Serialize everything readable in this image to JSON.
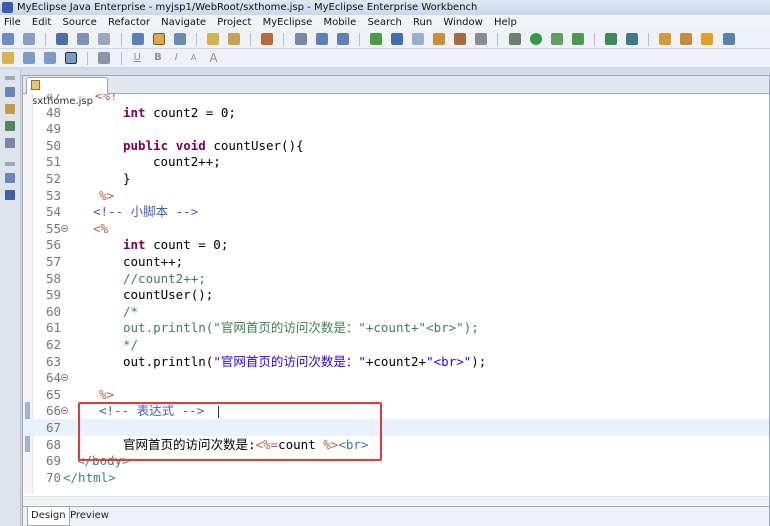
{
  "window": {
    "title": "MyEclipse Java Enterprise - myjsp1/WebRoot/sxthome.jsp - MyEclipse Enterprise Workbench"
  },
  "menu": [
    "File",
    "Edit",
    "Source",
    "Refactor",
    "Navigate",
    "Project",
    "MyEclipse",
    "Mobile",
    "Search",
    "Run",
    "Window",
    "Help"
  ],
  "format_toolbar": {
    "underline": "U",
    "bold": "B",
    "italic": "I",
    "font_small": "A",
    "font_large": "A"
  },
  "editor_tab": {
    "label": "*sxthome.jsp"
  },
  "code_lines": [
    {
      "num": "47",
      "fold": false,
      "indent": 32,
      "segs": [
        {
          "c": "tag",
          "t": "<%!"
        }
      ]
    },
    {
      "num": "48",
      "fold": false,
      "indent": 60,
      "segs": [
        {
          "c": "kw",
          "t": "int"
        },
        {
          "c": "plain",
          "t": " count2 = 0;"
        }
      ]
    },
    {
      "num": "49",
      "fold": false,
      "indent": 60,
      "segs": []
    },
    {
      "num": "50",
      "fold": false,
      "indent": 60,
      "segs": [
        {
          "c": "kw",
          "t": "public"
        },
        {
          "c": "plain",
          "t": " "
        },
        {
          "c": "kw",
          "t": "void"
        },
        {
          "c": "plain",
          "t": " countUser(){"
        }
      ]
    },
    {
      "num": "51",
      "fold": false,
      "indent": 90,
      "segs": [
        {
          "c": "plain",
          "t": "count2++;"
        }
      ]
    },
    {
      "num": "52",
      "fold": false,
      "indent": 60,
      "segs": [
        {
          "c": "plain",
          "t": "}"
        }
      ]
    },
    {
      "num": "53",
      "fold": false,
      "indent": 36,
      "segs": [
        {
          "c": "tag",
          "t": "%>"
        }
      ]
    },
    {
      "num": "54",
      "fold": false,
      "indent": 30,
      "segs": [
        {
          "c": "cmt",
          "t": "<!-- 小脚本 -->"
        }
      ]
    },
    {
      "num": "55",
      "fold": true,
      "indent": 30,
      "segs": [
        {
          "c": "tag",
          "t": "<%"
        }
      ]
    },
    {
      "num": "56",
      "fold": false,
      "indent": 60,
      "segs": [
        {
          "c": "kw",
          "t": "int"
        },
        {
          "c": "plain",
          "t": " count = 0;"
        }
      ]
    },
    {
      "num": "57",
      "fold": false,
      "indent": 60,
      "segs": [
        {
          "c": "plain",
          "t": "count++;"
        }
      ]
    },
    {
      "num": "58",
      "fold": false,
      "indent": 60,
      "segs": [
        {
          "c": "jcmt",
          "t": "//count2++;"
        }
      ]
    },
    {
      "num": "59",
      "fold": false,
      "indent": 60,
      "segs": [
        {
          "c": "plain",
          "t": "countUser();"
        }
      ]
    },
    {
      "num": "60",
      "fold": false,
      "indent": 60,
      "segs": [
        {
          "c": "jcmt",
          "t": "/*"
        }
      ]
    },
    {
      "num": "61",
      "fold": false,
      "indent": 60,
      "segs": [
        {
          "c": "jcmt",
          "t": "out.println(\"官网首页的访问次数是：\"+count+\"<br>\");"
        }
      ]
    },
    {
      "num": "62",
      "fold": false,
      "indent": 60,
      "segs": [
        {
          "c": "jcmt",
          "t": "*/"
        }
      ]
    },
    {
      "num": "63",
      "fold": false,
      "indent": 60,
      "segs": [
        {
          "c": "plain",
          "t": "out.println("
        },
        {
          "c": "str",
          "t": "\"官网首页的访问次数是：\""
        },
        {
          "c": "plain",
          "t": "+count2+"
        },
        {
          "c": "str",
          "t": "\"<br>\""
        },
        {
          "c": "plain",
          "t": ");"
        }
      ]
    },
    {
      "num": "64",
      "fold": true,
      "indent": 60,
      "segs": []
    },
    {
      "num": "65",
      "fold": false,
      "indent": 36,
      "segs": [
        {
          "c": "tag",
          "t": "%>"
        }
      ]
    },
    {
      "num": "66",
      "fold": true,
      "indent": 36,
      "segs": [
        {
          "c": "cmt",
          "t": "<!-- 表达式 -->"
        }
      ]
    },
    {
      "num": "67",
      "fold": false,
      "indent": 36,
      "cur": true,
      "segs": []
    },
    {
      "num": "68",
      "fold": false,
      "indent": 60,
      "segs": [
        {
          "c": "plain",
          "t": "官网首页的访问次数是:"
        },
        {
          "c": "tag",
          "t": "<%="
        },
        {
          "c": "plain",
          "t": "count "
        },
        {
          "c": "tag",
          "t": "%>"
        },
        {
          "c": "tagb",
          "t": "<br>"
        }
      ]
    },
    {
      "num": "69",
      "fold": false,
      "indent": 14,
      "segs": [
        {
          "c": "tagb",
          "t": "</body>"
        }
      ]
    },
    {
      "num": "70",
      "fold": false,
      "indent": 0,
      "segs": [
        {
          "c": "tagb",
          "t": "</html>"
        }
      ]
    }
  ],
  "bottom_tabs": [
    "Design",
    "Preview"
  ],
  "colors": {
    "keyword": "#7f0055",
    "jsp_tag": "#bf5f3f",
    "html_tag": "#3f7f7f",
    "html_comment": "#3f5fbf",
    "java_comment": "#3f7f5f",
    "string": "#2a00ff",
    "highlight_box": "#e53935"
  }
}
